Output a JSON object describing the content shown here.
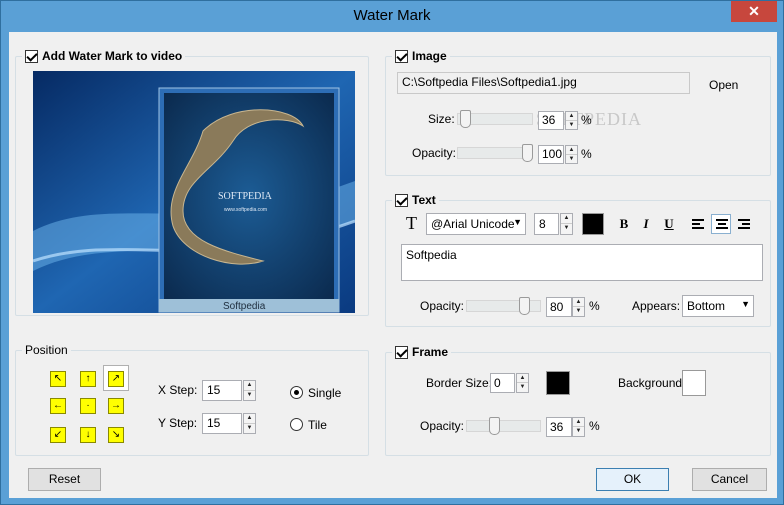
{
  "window": {
    "title": "Water Mark",
    "close_symbol": "✕",
    "colors": {
      "title_bar": "#5aa0d6",
      "client_bg": "#f0f0f0",
      "arrow_buttons": "#ffff00"
    }
  },
  "preview_group": {
    "label": "Add Water Mark to video",
    "checked": true,
    "preview_watermark_title": "SOFTPEDIA",
    "preview_watermark_sub": "www.softpedia.com",
    "preview_caption": "Softpedia"
  },
  "position_group": {
    "label": "Position",
    "arrows": [
      "↖",
      "↑",
      "↗",
      "←",
      "·",
      "→",
      "↙",
      "↓",
      "↘"
    ],
    "selected_index": 2,
    "x_step_label": "X Step:",
    "x_step_value": "15",
    "y_step_label": "Y Step:",
    "y_step_value": "15",
    "mode_single": "Single",
    "mode_tile": "Tile",
    "mode_selected": "Single"
  },
  "image_group": {
    "label": "Image",
    "checked": true,
    "path": "C:\\Softpedia Files\\Softpedia1.jpg",
    "open_label": "Open",
    "size_label": "Size:",
    "size_value": "36",
    "size_unit": "%",
    "size_level": 0.36,
    "opacity_label": "Opacity:",
    "opacity_value": "100",
    "opacity_unit": "%",
    "opacity_level": 1.0,
    "watermark_text": "SOFTPEDIA"
  },
  "text_group": {
    "label": "Text",
    "checked": true,
    "font": "@Arial Unicode",
    "font_size": "8",
    "color": "#000000",
    "bold": "B",
    "italic": "I",
    "underline": "U",
    "text_value": "Softpedia",
    "opacity_label": "Opacity:",
    "opacity_value": "80",
    "opacity_unit": "%",
    "opacity_level": 0.8,
    "appears_label": "Appears:",
    "appears_value": "Bottom",
    "align_selected": "center"
  },
  "frame_group": {
    "label": "Frame",
    "checked": true,
    "border_size_label": "Border Size:",
    "border_size_value": "0",
    "border_color": "#000000",
    "background_label": "Background:",
    "background_color": "#ffffff",
    "opacity_label": "Opacity:",
    "opacity_value": "36",
    "opacity_unit": "%",
    "opacity_level": 0.36
  },
  "buttons": {
    "reset": "Reset",
    "ok": "OK",
    "cancel": "Cancel"
  }
}
